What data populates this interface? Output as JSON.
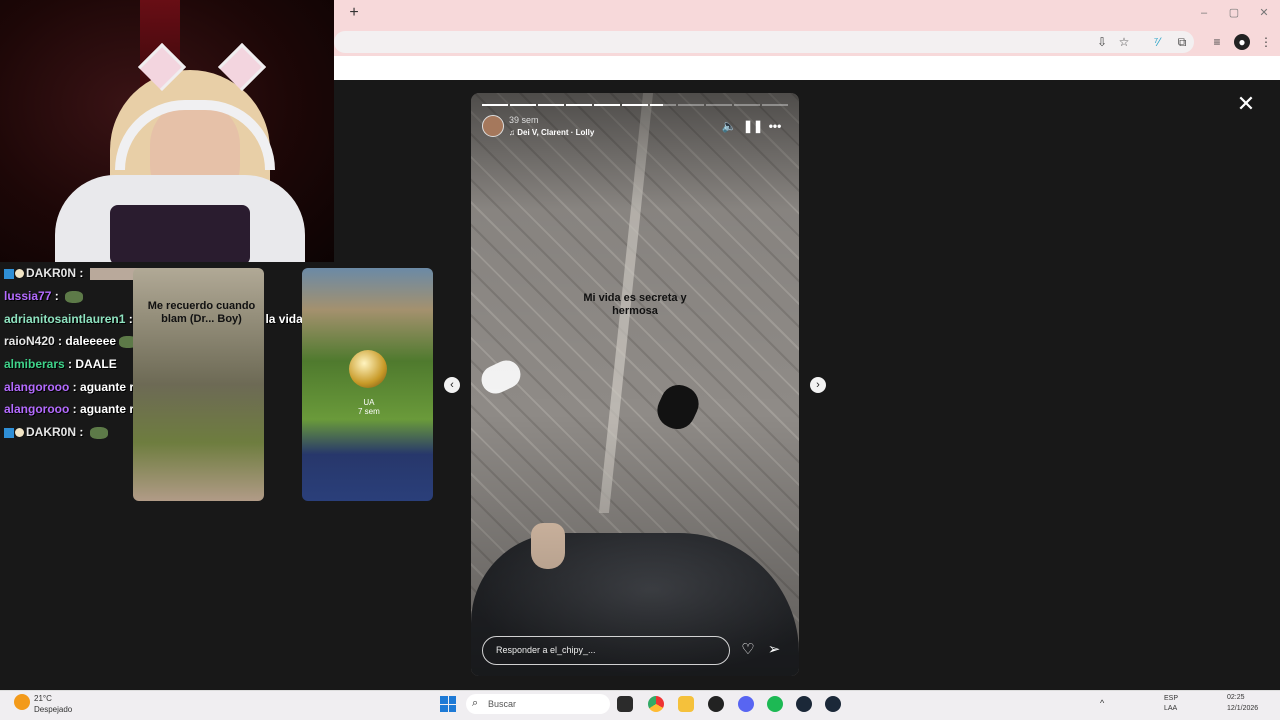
{
  "browser": {
    "new_tab": "+",
    "win_min": "–",
    "win_max": "▢",
    "win_close": "✕"
  },
  "stream_chat": [
    {
      "user": "DAKR0N",
      "color": "#e6e6e6",
      "sep": " : ",
      "msg": "",
      "badges": true,
      "emote": "wide"
    },
    {
      "user": "lussia77",
      "color": "#b46bff",
      "sep": " : ",
      "msg": "",
      "badges": false,
      "emote": "frog"
    },
    {
      "user": "adrianitosaintlauren1",
      "color": "#8fe3c0",
      "sep": " : ",
      "msg": "la mejor experiencia d la vida",
      "badges": false,
      "emote": ""
    },
    {
      "user": "raioN420",
      "color": "#e6e6e6",
      "sep": " : ",
      "msg": "daleeeee",
      "badges": false,
      "emote": "frog"
    },
    {
      "user": "almiberars",
      "color": "#3fd38a",
      "sep": " : ",
      "msg": "DAALE",
      "badges": false,
      "emote": ""
    },
    {
      "user": "alangorooo",
      "color": "#b46bff",
      "sep": " : ",
      "msg": "aguante river",
      "badges": false,
      "emote": ""
    },
    {
      "user": "alangorooo",
      "color": "#b46bff",
      "sep": " : ",
      "msg": "aguante river",
      "badges": false,
      "emote": ""
    },
    {
      "user": "DAKR0N",
      "color": "#e6e6e6",
      "sep": " : ",
      "msg": "",
      "badges": true,
      "emote": "frog"
    }
  ],
  "thumbnails": {
    "left_caption": "Me recuerdo cuando blam (Dr... Boy)",
    "right_meta": "UA\n7 sem"
  },
  "story": {
    "time": "39 sem",
    "song": "Dei V, Clarent · Lolly",
    "caption": "Mi vida es secreta y hermosa",
    "reply_placeholder": "Responder a el_chipy_...",
    "progress_total": 11,
    "progress_current": 7,
    "progress_fraction": 0.5
  },
  "taskbar": {
    "temp": "21°C",
    "weather": "Despejado",
    "search_placeholder": "Buscar",
    "lang_top": "ESP",
    "lang_bottom": "LAA",
    "time": "02:25",
    "date": "12/1/2026"
  },
  "colors": {
    "browser_chrome": "#f7d9da",
    "accent_blue": "#1e7ad6"
  }
}
